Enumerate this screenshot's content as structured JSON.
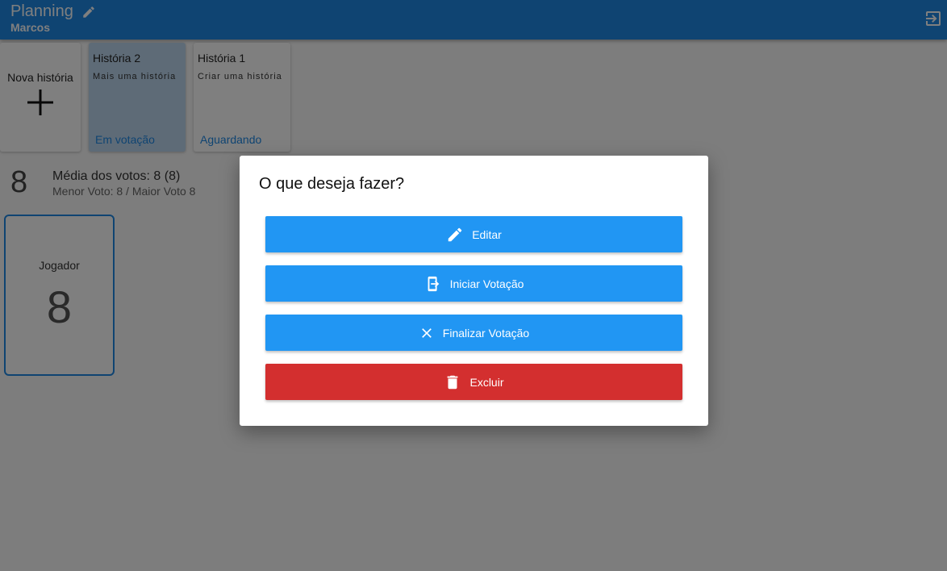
{
  "header": {
    "title": "Planning",
    "subtitle": "Marcos",
    "icons": {
      "edit": "edit-pencil-icon",
      "exit": "exit-icon"
    }
  },
  "stories": {
    "new_label": "Nova história",
    "items": [
      {
        "title": "História 2",
        "description": "Mais uma história",
        "status": "Em votação",
        "active": true
      },
      {
        "title": "História 1",
        "description": "Criar uma história",
        "status": "Aguardando",
        "active": false
      }
    ]
  },
  "stats": {
    "big_value": "8",
    "average": "Média dos votos: 8 (8)",
    "min_max": "Menor Voto: 8 / Maior Voto 8"
  },
  "player": {
    "name": "Jogador",
    "vote": "8"
  },
  "dialog": {
    "title": "O que deseja fazer?",
    "buttons": [
      {
        "label": "Editar",
        "icon": "pencil-icon"
      },
      {
        "label": "Iniciar Votação",
        "icon": "enter-vote-icon"
      },
      {
        "label": "Finalizar Votação",
        "icon": "close-icon"
      },
      {
        "label": "Excluir",
        "icon": "trash-icon"
      }
    ]
  },
  "colors": {
    "primary": "#1e88e5",
    "button": "#2196f3",
    "danger": "#d32f2f",
    "active_card": "#bcd6ee"
  }
}
